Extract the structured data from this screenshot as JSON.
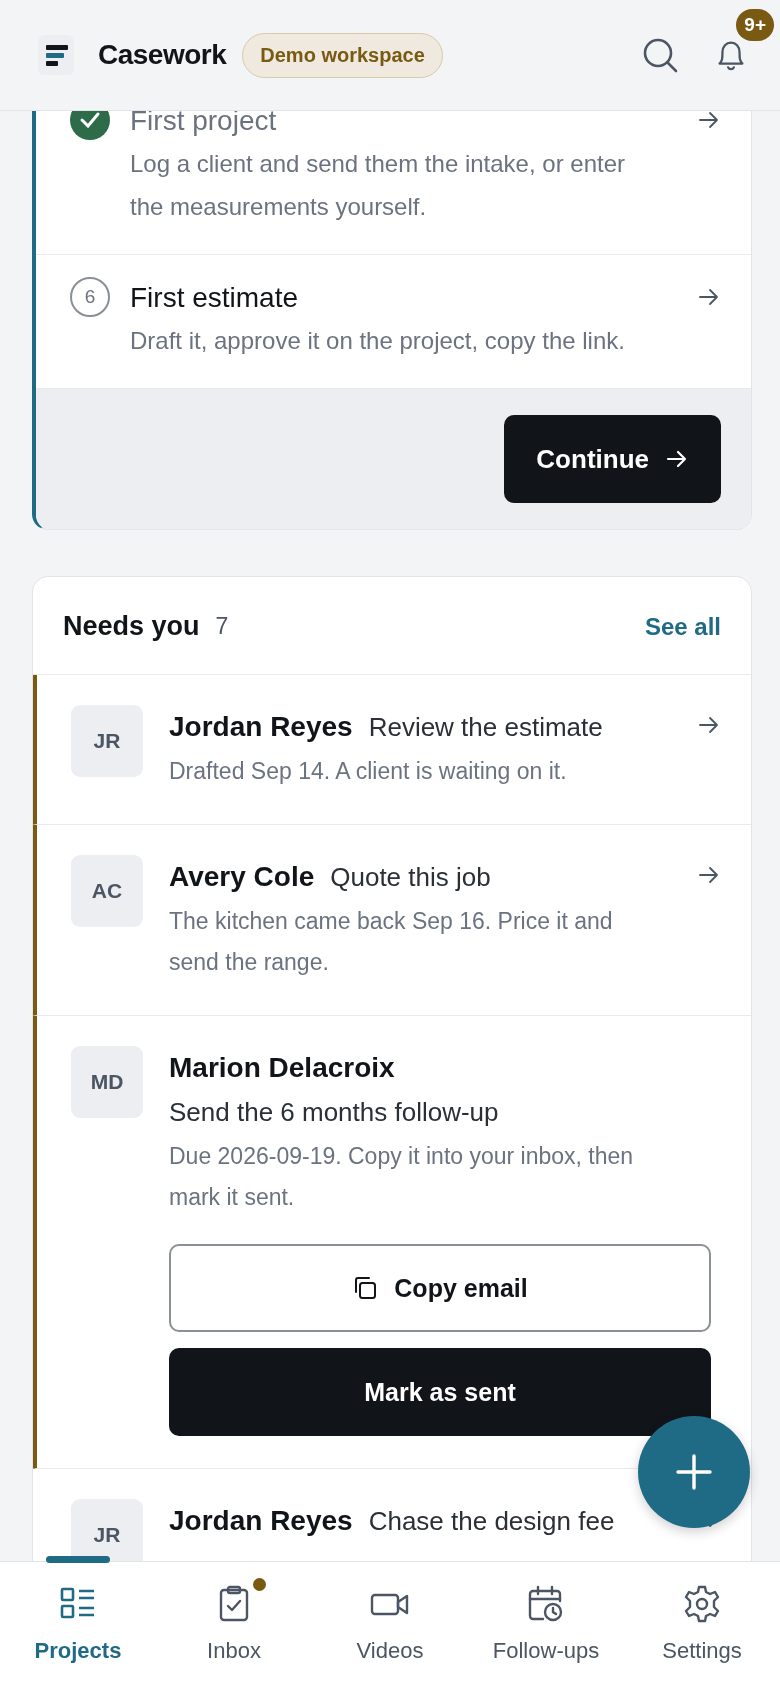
{
  "header": {
    "app_name": "Casework",
    "workspace_badge": "Demo workspace",
    "notifications_badge": "9+"
  },
  "setup_card": {
    "steps": [
      {
        "done": true,
        "title": "First project",
        "description": "Log a client and send them the intake, or enter the measurements yourself."
      },
      {
        "done": false,
        "number": "6",
        "title": "First estimate",
        "description": "Draft it, approve it on the project, copy the link."
      }
    ],
    "button": "Continue"
  },
  "needs_you": {
    "title": "Needs you",
    "count": "7",
    "link": "See all",
    "items": [
      {
        "initials": "JR",
        "name": "Jordan Reyes",
        "action": "Review the estimate",
        "detail": "Drafted Sep 14. A client is waiting on it.",
        "accent": true
      },
      {
        "initials": "AC",
        "name": "Avery Cole",
        "action": "Quote this job",
        "detail": "The kitchen came back Sep 16. Price it and send the range.",
        "accent": true
      },
      {
        "initials": "MD",
        "name": "Marion Delacroix",
        "action": "Send the 6 months follow-up",
        "detail": "Due 2026-09-19. Copy it into your inbox, then mark it sent.",
        "accent": true,
        "buttons": [
          {
            "label": "Copy email",
            "kind": "secondary"
          },
          {
            "label": "Mark as sent",
            "kind": "primary"
          }
        ]
      },
      {
        "initials": "JR",
        "name": "Jordan Reyes",
        "action": "Chase the design fee",
        "accent": false
      }
    ]
  },
  "nav": [
    {
      "label": "Projects",
      "selected": true,
      "unread": false
    },
    {
      "label": "Inbox",
      "selected": false,
      "unread": true
    },
    {
      "label": "Videos",
      "selected": false,
      "unread": false
    },
    {
      "label": "Follow-ups",
      "selected": false,
      "unread": false
    },
    {
      "label": "Settings",
      "selected": false,
      "unread": false
    }
  ]
}
